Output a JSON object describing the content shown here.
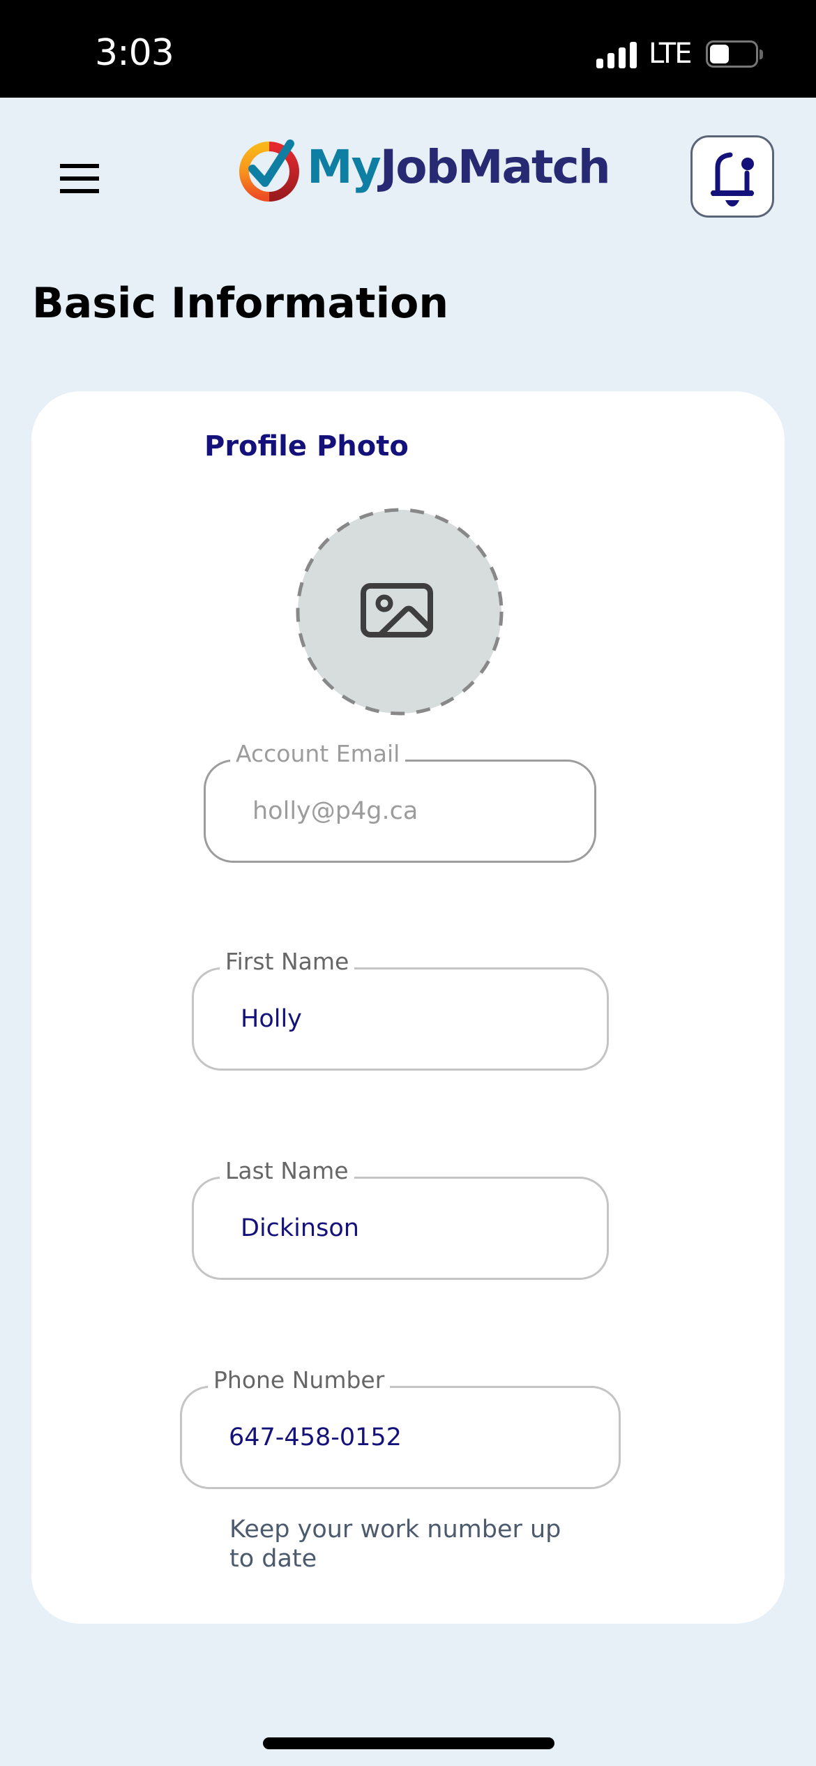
{
  "status_bar": {
    "time": "3:03",
    "network": "LTE",
    "signal_bars": 4,
    "battery_level_percent": 35
  },
  "header": {
    "menu_icon": "hamburger-menu-icon",
    "logo": {
      "part1": "My",
      "part2": "JobMatch",
      "colors": {
        "my": "#0E7FA3",
        "jobmatch": "#272A72"
      }
    },
    "notification_icon": "bell-with-badge-icon"
  },
  "page": {
    "title": "Basic Information"
  },
  "card": {
    "profile_photo": {
      "label": "Profile Photo",
      "placeholder_icon": "image-icon"
    },
    "fields": {
      "email": {
        "label": "Account Email",
        "value": "holly@p4g.ca",
        "disabled": true
      },
      "first_name": {
        "label": "First Name",
        "value": "Holly"
      },
      "last_name": {
        "label": "Last Name",
        "value": "Dickinson"
      },
      "phone": {
        "label": "Phone Number",
        "value": "647-458-0152",
        "helper": "Keep your work number up to date"
      }
    }
  },
  "colors": {
    "background": "#E6F0F6",
    "accent_navy": "#14127A",
    "label_gray": "#666666",
    "helper_text": "#4C5A6E"
  }
}
